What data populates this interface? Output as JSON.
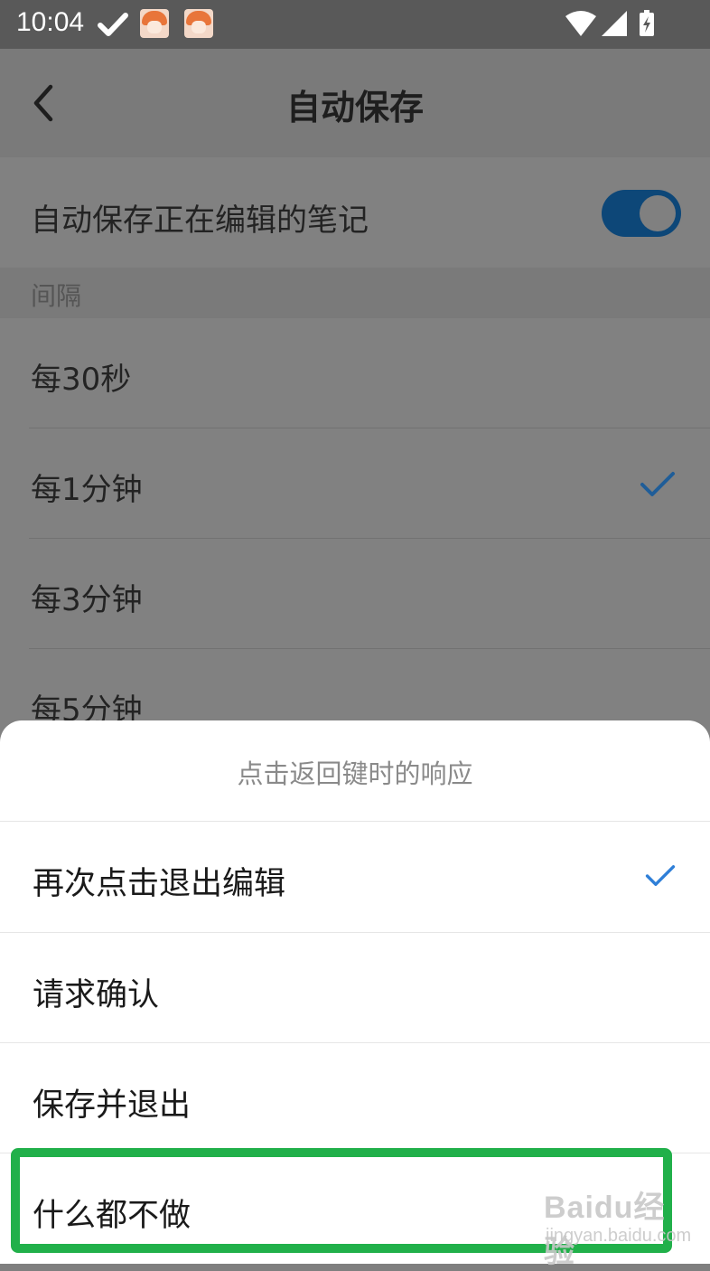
{
  "status_bar": {
    "time": "10:04"
  },
  "header": {
    "title": "自动保存"
  },
  "auto_save_row": {
    "label": "自动保存正在编辑的笔记",
    "enabled": true
  },
  "interval_section": {
    "header": "间隔",
    "items": [
      {
        "label": "每30秒",
        "selected": false
      },
      {
        "label": "每1分钟",
        "selected": true
      },
      {
        "label": "每3分钟",
        "selected": false
      },
      {
        "label": "每5分钟",
        "selected": false
      }
    ]
  },
  "sheet": {
    "title": "点击返回键时的响应",
    "options": [
      {
        "label": "再次点击退出编辑",
        "selected": true
      },
      {
        "label": "请求确认",
        "selected": false
      },
      {
        "label": "保存并退出",
        "selected": false
      },
      {
        "label": "什么都不做",
        "selected": false
      }
    ]
  },
  "watermark": {
    "brand": "Baidu经验",
    "url": "jingyan.baidu.com"
  },
  "colors": {
    "accent": "#2f7fd8",
    "highlight": "#21b04a",
    "toggle": "#0d4778"
  }
}
